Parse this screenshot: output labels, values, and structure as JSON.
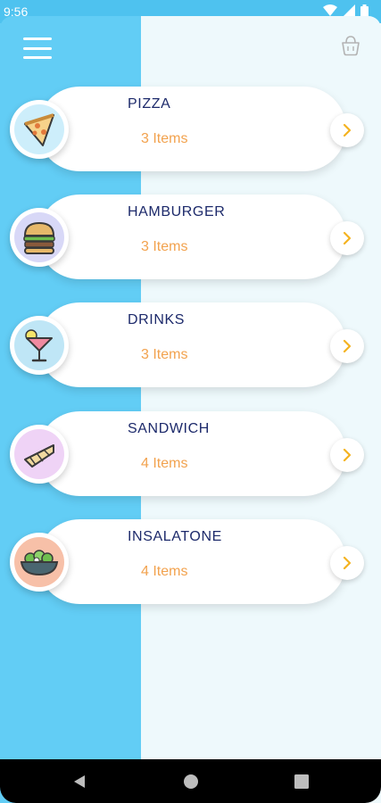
{
  "status_bar": {
    "time": "9:56"
  },
  "categories": [
    {
      "title": "PIZZA",
      "count": "3 Items",
      "image_bg": "#cdeefb"
    },
    {
      "title": "HAMBURGER",
      "count": "3 Items",
      "image_bg": "#d8d8f7"
    },
    {
      "title": "DRINKS",
      "count": "3 Items",
      "image_bg": "#bfe6f6"
    },
    {
      "title": "SANDWICH",
      "count": "4 Items",
      "image_bg": "#efd3f6"
    },
    {
      "title": "INSALATONE",
      "count": "4 Items",
      "image_bg": "#f7c0a8"
    }
  ],
  "colors": {
    "accent_blue": "#62cdf5",
    "title_navy": "#1d2a6b",
    "count_orange": "#f2a24e",
    "arrow_yellow": "#f4b321"
  },
  "icons": {
    "menu": "hamburger-menu-icon",
    "cart": "shopping-basket-icon",
    "arrow": "chevron-right-icon"
  }
}
